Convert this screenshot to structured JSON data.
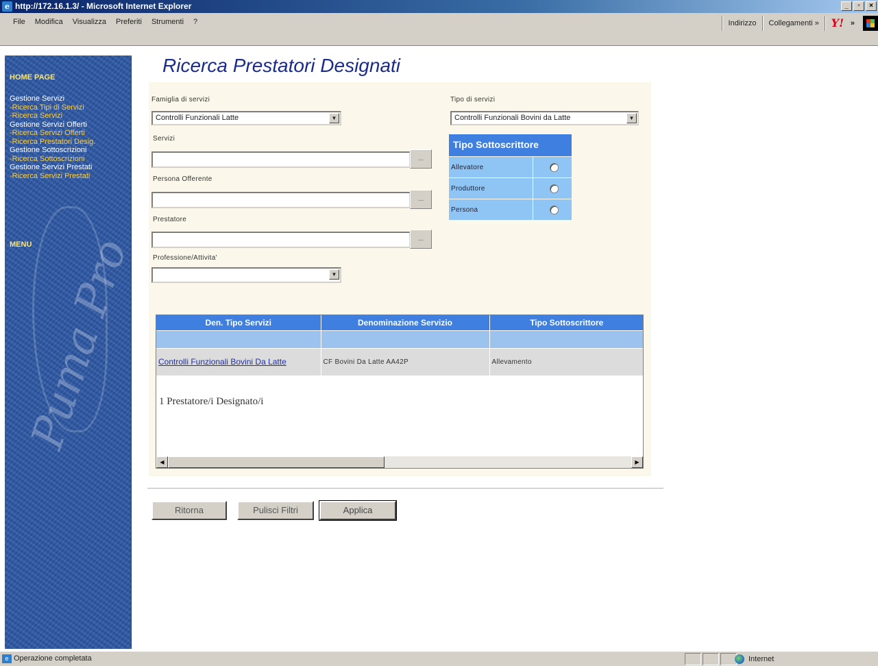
{
  "window": {
    "title": "http://172.16.1.3/ - Microsoft Internet Explorer",
    "min_label": "_",
    "max_label": "▫",
    "close_label": "×"
  },
  "menubar": {
    "items": [
      "File",
      "Modifica",
      "Visualizza",
      "Preferiti",
      "Strumenti",
      "?"
    ],
    "address_label": "Indirizzo",
    "links_label": "Collegamenti »",
    "chevron": "»"
  },
  "sidebar": {
    "home": "HOME PAGE",
    "groups": [
      {
        "label": "Gestione Servizi",
        "links": [
          "-Ricerca Tipi di Servizi",
          "-Ricerca Servizi"
        ]
      },
      {
        "label": "Gestione Servizi Offerti",
        "links": [
          "-Ricerca Servizi Offerti",
          "-Ricerca Prestatori Desig."
        ]
      },
      {
        "label": "Gestione Sottoscrizioni",
        "links": [
          "-Ricerca Sottoscrizioni"
        ]
      },
      {
        "label": "Gestione Servizi Prestati",
        "links": [
          "-Ricerca Servizi Prestati"
        ]
      }
    ],
    "menu": "MENU"
  },
  "page": {
    "title": "Ricerca Prestatori Designati"
  },
  "filters": {
    "famiglia_label": "Famiglia di servizi",
    "famiglia_value": "Controlli Funzionali  Latte",
    "tipo_label": "Tipo di servizi",
    "tipo_value": "Controlli Funzionali Bovini da Latte",
    "servizi_label": "Servizi",
    "servizi_value": "",
    "persona_label": "Persona Offerente",
    "persona_value": "",
    "prestatore_label": "Prestatore",
    "prestatore_value": "",
    "professione_label": "Professione/Attivita'",
    "professione_value": "",
    "dots": "...",
    "dropdown_arrow": "▼"
  },
  "tipo_sottoscrittore": {
    "title": "Tipo Sottoscrittore",
    "options": [
      "Allevatore",
      "Produttore",
      "Persona"
    ]
  },
  "results": {
    "columns": [
      "Den. Tipo Servizi",
      "Denominazione Servizio",
      "Tipo Sottoscrittore"
    ],
    "rows": [
      {
        "tipo": "Controlli Funzionali Bovini Da Latte",
        "servizio": "CF Bovini Da Latte AA42P",
        "sottoscrittore": "Allevamento"
      }
    ],
    "count_text": "1 Prestatore/i Designato/i",
    "scroll_left": "◀",
    "scroll_right": "▶"
  },
  "buttons": {
    "ritorna": "Ritorna",
    "pulisci": "Pulisci Filtri",
    "applica": "Applica"
  },
  "statusbar": {
    "text": "Operazione completata",
    "zone": "Internet"
  }
}
